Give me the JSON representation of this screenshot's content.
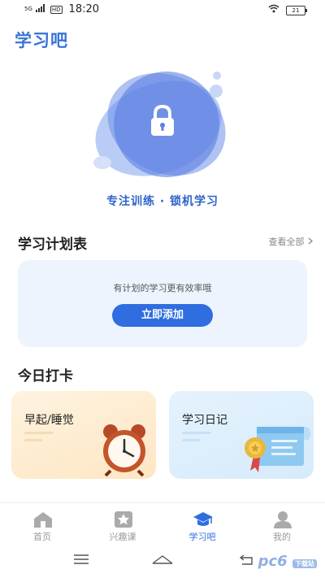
{
  "status": {
    "signal": "5G",
    "network_badge": "HD",
    "time": "18:20",
    "battery": "21"
  },
  "app_title": "学习吧",
  "hero": {
    "caption": "专注训练 · 锁机学习"
  },
  "plan": {
    "title": "学习计划表",
    "view_all": "查看全部",
    "tip": "有计划的学习更有效率哦",
    "add_button": "立即添加"
  },
  "checkin": {
    "title": "今日打卡",
    "cards": [
      {
        "label": "早起/睡觉",
        "icon": "alarm-clock-icon"
      },
      {
        "label": "学习日记",
        "icon": "certificate-scroll-icon"
      }
    ]
  },
  "tabs": [
    {
      "label": "首页",
      "icon": "home-icon",
      "active": false
    },
    {
      "label": "兴趣课",
      "icon": "star-icon",
      "active": false
    },
    {
      "label": "学习吧",
      "icon": "graduation-cap-icon",
      "active": true
    },
    {
      "label": "我的",
      "icon": "user-icon",
      "active": false
    }
  ],
  "watermark": {
    "text": "pc6",
    "suffix": "下载站"
  },
  "colors": {
    "accent": "#2f6de0",
    "title": "#3a73d6",
    "inactive_tab": "#999999"
  }
}
